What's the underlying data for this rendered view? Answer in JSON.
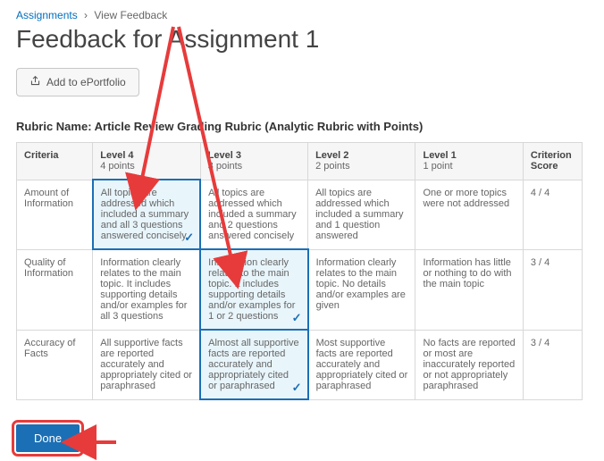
{
  "breadcrumb": {
    "parent": "Assignments",
    "current": "View Feedback"
  },
  "title": "Feedback for Assignment 1",
  "eportfolio_label": "Add to ePortfolio",
  "rubric_label": "Rubric Name: Article Review Grading Rubric (Analytic Rubric with Points)",
  "headers": {
    "criteria": "Criteria",
    "score": "Criterion Score",
    "levels": [
      {
        "name": "Level 4",
        "points": "4 points"
      },
      {
        "name": "Level 3",
        "points": "3 points"
      },
      {
        "name": "Level 2",
        "points": "2 points"
      },
      {
        "name": "Level 1",
        "points": "1 point"
      }
    ]
  },
  "rows": [
    {
      "name": "Amount of Information",
      "score": "4 / 4",
      "selected": 0,
      "cells": [
        "All topics are addressed which included a summary and all 3 questions answered concisely",
        "All topics are addressed which included a summary and 2 questions answered concisely",
        "All topics are addressed which included a summary and 1 question answered",
        "One or more topics were not addressed"
      ]
    },
    {
      "name": "Quality of Information",
      "score": "3 / 4",
      "selected": 1,
      "cells": [
        "Information clearly relates to the main topic. It includes supporting details and/or examples for all 3 questions",
        "Information clearly relates to the main topic. It includes supporting details and/or examples for 1 or 2 questions",
        "Information clearly relates to the main topic. No details and/or examples are given",
        "Information has little or nothing to do with the main topic"
      ]
    },
    {
      "name": "Accuracy of Facts",
      "score": "3 / 4",
      "selected": 1,
      "cells": [
        "All supportive facts are reported accurately and appropriately cited or paraphrased",
        "Almost all supportive facts are reported accurately and appropriately cited or paraphrased",
        "Most supportive facts are reported accurately and appropriately cited or paraphrased",
        "No facts are reported or most are inaccurately reported or not appropriately paraphrased"
      ]
    }
  ],
  "done_label": "Done"
}
